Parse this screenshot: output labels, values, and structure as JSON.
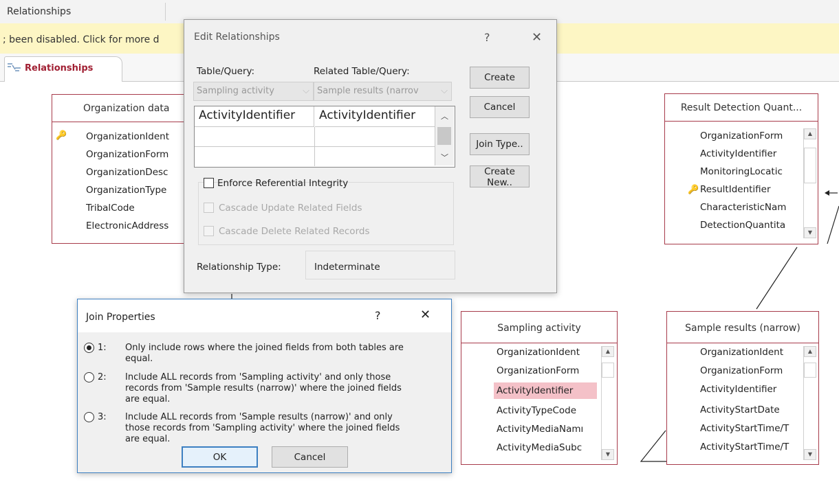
{
  "window": {
    "title": "Relationships"
  },
  "infobar": {
    "text": "; been disabled. Click for more d"
  },
  "tab": {
    "label": "Relationships",
    "icon": "relationships-icon"
  },
  "tables": {
    "organization": {
      "title": "Organization data",
      "fields": [
        "OrganizationIdent",
        "OrganizationForm",
        "OrganizationDesc",
        "OrganizationType",
        "TribalCode",
        "ElectronicAddress"
      ]
    },
    "result_detection": {
      "title": "Result Detection Quant...",
      "fields": [
        "OrganizationForm",
        "ActivityIdentifier",
        "MonitoringLocatic",
        "ResultIdentifier",
        "CharacteristicNam",
        "DetectionQuantita"
      ]
    },
    "sampling_activity": {
      "title": "Sampling activity",
      "fields": [
        "OrganizationIdent",
        "OrganizationForm",
        "ActivityIdentifier",
        "ActivityTypeCode",
        "ActivityMediaNamı",
        "ActivityMediaSubc"
      ]
    },
    "sample_results": {
      "title": "Sample results (narrow)",
      "fields": [
        "OrganizationIdent",
        "OrganizationForm",
        "ActivityIdentifier",
        "ActivityStartDate",
        "ActivityStartTime/T",
        "ActivityStartTime/T"
      ]
    }
  },
  "edit_relationships": {
    "title": "Edit Relationships",
    "help": "?",
    "close": "✕",
    "table_query_label": "Table/Query:",
    "related_label": "Related Table/Query:",
    "table_value": "Sampling activity",
    "related_value": "Sample results (narrov",
    "grid_left": "ActivityIdentifier",
    "grid_right": "ActivityIdentifier",
    "enforce": "Enforce Referential Integrity",
    "cascade_update": "Cascade Update Related Fields",
    "cascade_delete": "Cascade Delete Related Records",
    "relationship_type_label": "Relationship Type:",
    "relationship_type_value": "Indeterminate",
    "buttons": {
      "create": "Create",
      "cancel": "Cancel",
      "join_type": "Join Type..",
      "create_new": "Create New.."
    }
  },
  "join_properties": {
    "title": "Join Properties",
    "help": "?",
    "close": "✕",
    "options": [
      {
        "num": "1:",
        "lines": [
          "Only include rows where the joined fields from both tables are",
          "equal."
        ]
      },
      {
        "num": "2:",
        "lines": [
          "Include ALL records from 'Sampling activity' and only those",
          "records from 'Sample results (narrow)' where the joined fields",
          "are equal."
        ]
      },
      {
        "num": "3:",
        "lines": [
          "Include ALL records from 'Sample results (narrow)' and only",
          "those records from 'Sampling activity' where the joined fields",
          "are equal."
        ]
      }
    ],
    "selected_option": 1,
    "ok": "OK",
    "cancel": "Cancel"
  },
  "colors": {
    "table_border": "#a73a4a",
    "highlight_field": "#f4c1c8",
    "tab_label": "#a12033",
    "infobar": "#fdf6c4"
  }
}
